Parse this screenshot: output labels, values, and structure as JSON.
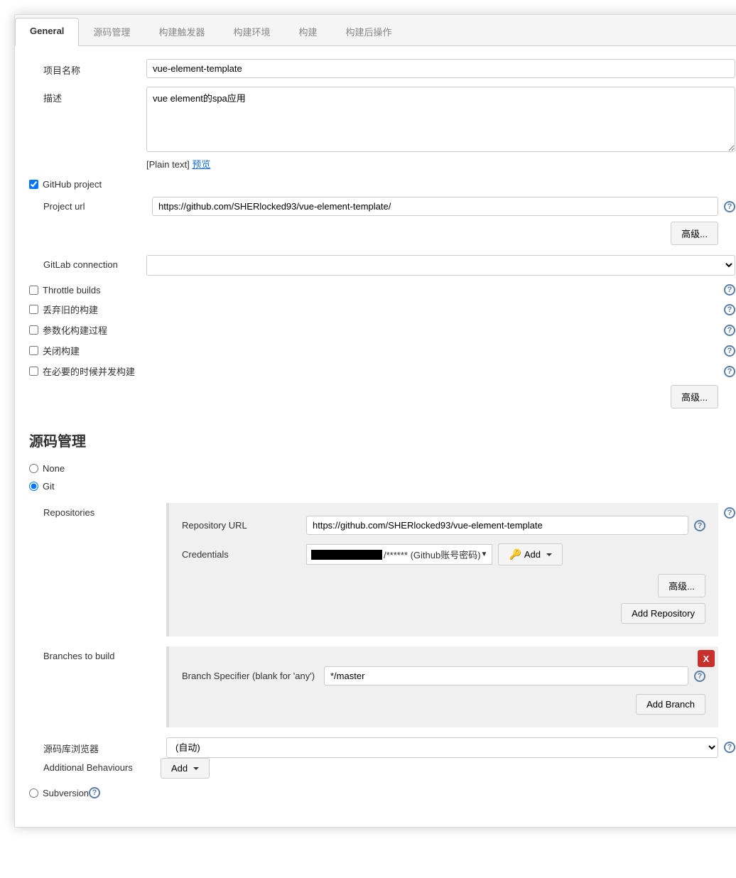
{
  "tabs": [
    "General",
    "源码管理",
    "构建触发器",
    "构建环境",
    "构建",
    "构建后操作"
  ],
  "active_tab": 0,
  "general": {
    "label_project_name": "项目名称",
    "project_name": "vue-element-template",
    "label_desc": "描述",
    "desc": "vue element的spa应用",
    "hint_plain": "[Plain text] ",
    "hint_preview": "预览",
    "cb_github": "GitHub project",
    "label_project_url": "Project url",
    "project_url": "https://github.com/SHERlocked93/vue-element-template/",
    "btn_advanced": "高级...",
    "label_gitlab": "GitLab connection",
    "gitlab_value": "",
    "cb_throttle": "Throttle builds",
    "cb_discard": "丢弃旧的构建",
    "cb_param": "参数化构建过程",
    "cb_close": "关闭构建",
    "cb_concurrent": "在必要的时候并发构建"
  },
  "scm": {
    "section_title": "源码管理",
    "radio_none": "None",
    "radio_git": "Git",
    "label_repositories": "Repositories",
    "label_repo_url": "Repository URL",
    "repo_url": "https://github.com/SHERlocked93/vue-element-template",
    "label_credentials": "Credentials",
    "cred_text": "/****** (Github账号密码)",
    "btn_add": "Add",
    "btn_advanced": "高级...",
    "btn_add_repo": "Add Repository",
    "label_branches": "Branches to build",
    "label_branch_spec": "Branch Specifier (blank for 'any')",
    "branch_spec": "*/master",
    "btn_add_branch": "Add Branch",
    "label_browser": "源码库浏览器",
    "browser_value": "(自动)",
    "label_additional": "Additional Behaviours",
    "btn_add2": "Add",
    "radio_svn": "Subversion"
  }
}
